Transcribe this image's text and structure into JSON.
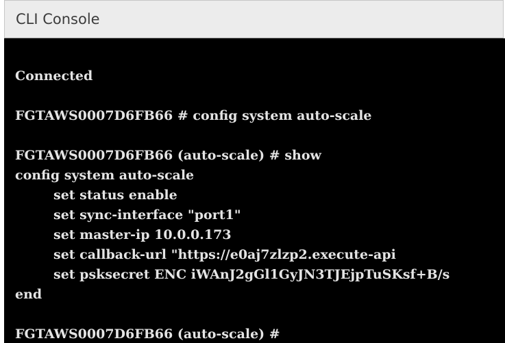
{
  "window": {
    "title": "CLI Console"
  },
  "terminal": {
    "lines": [
      "Connected",
      "FGTAWS0007D6FB66 # config system auto-scale",
      "FGTAWS0007D6FB66 (auto-scale) # show",
      "config system auto-scale",
      "set status enable",
      "set sync-interface \"port1\"",
      "set master-ip 10.0.0.173",
      "set callback-url \"https://e0aj7zlzp2.execute-api",
      "set psksecret ENC iWAnJ2gGl1GyJN3TJEjpTuSKsf+B/s",
      "end",
      "FGTAWS0007D6FB66 (auto-scale) #"
    ]
  }
}
